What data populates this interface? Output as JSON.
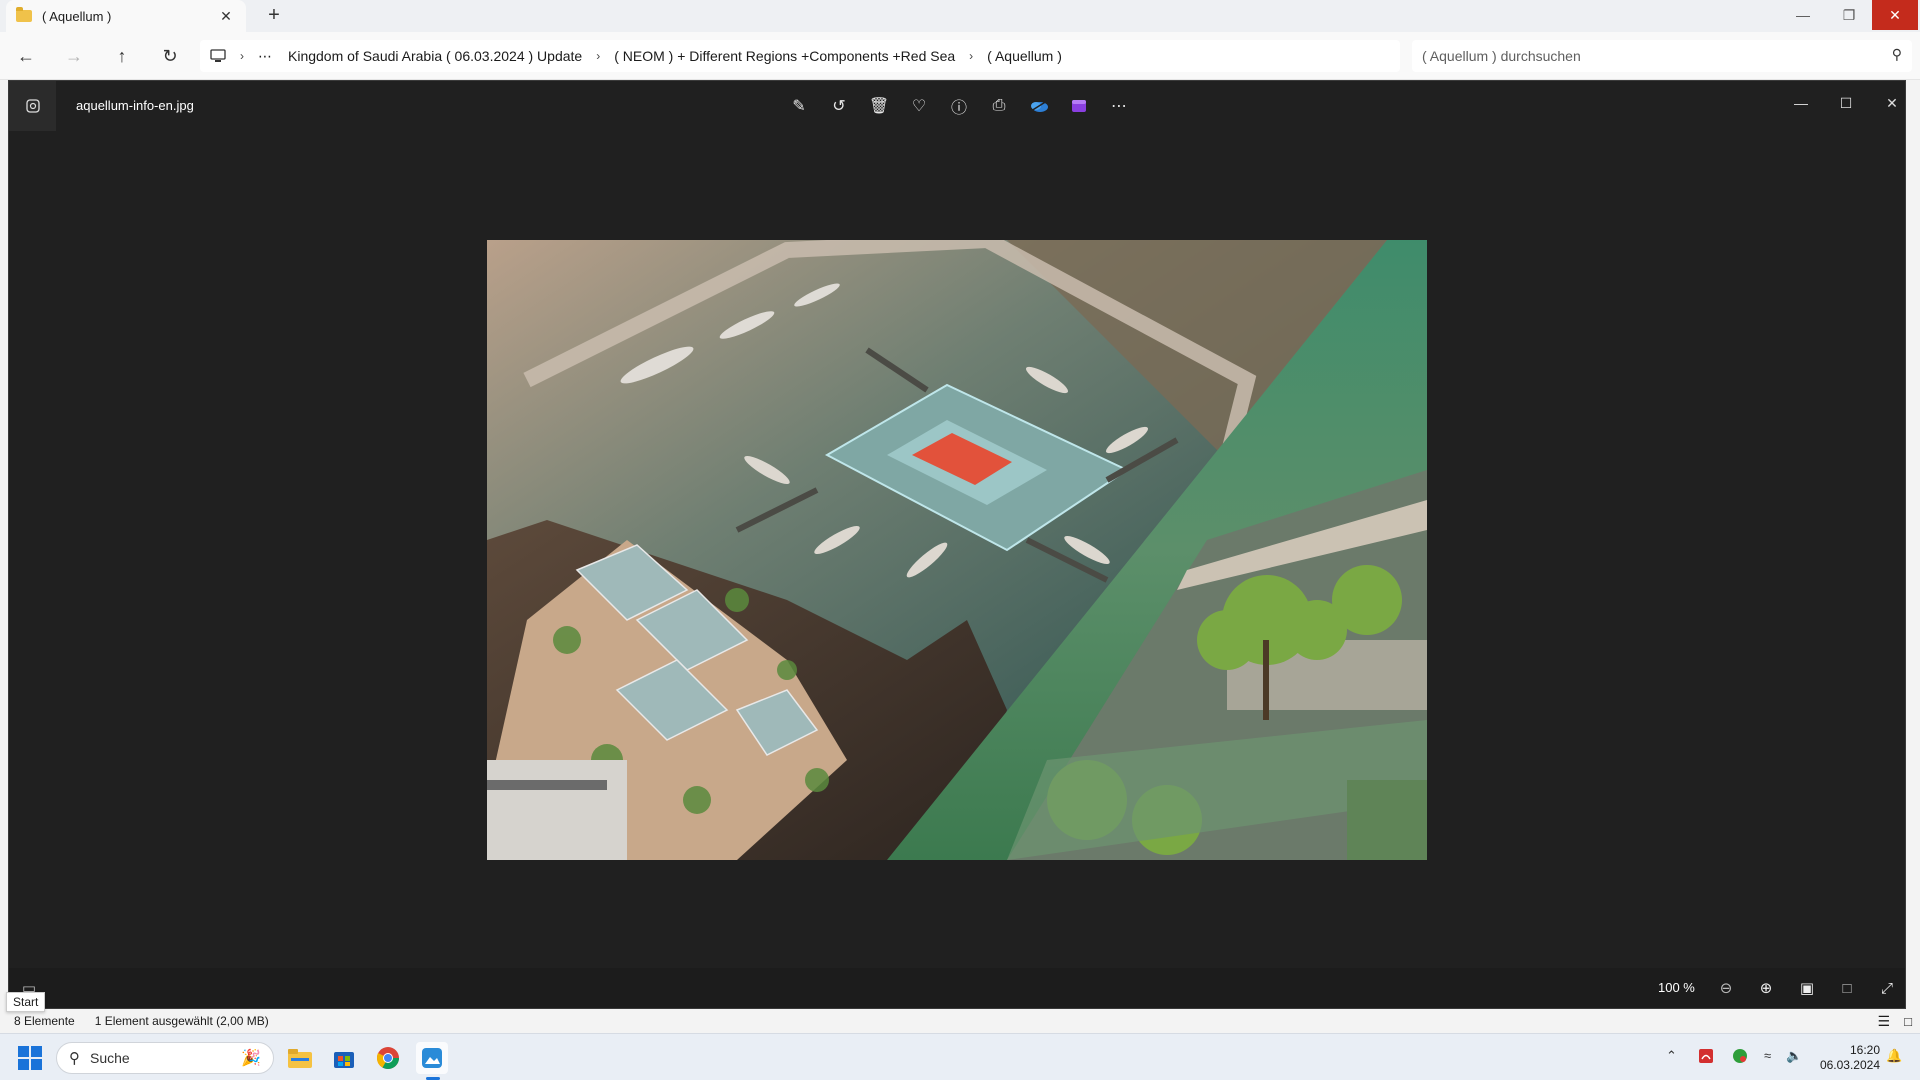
{
  "explorer": {
    "tab_title": "( Aquellum )",
    "tab_close": "✕",
    "new_tab": "+",
    "breadcrumb": [
      "Kingdom of Saudi Arabia ( 06.03.2024 ) Update",
      "( NEOM ) + Different Regions +Components +Red Sea",
      "( Aquellum )"
    ],
    "search_placeholder": "( Aquellum ) durchsuchen",
    "status": {
      "items_count": "8 Elemente",
      "selection": "1 Element ausgewählt (2,00 MB)"
    },
    "tooltip": "Start"
  },
  "viewer": {
    "file_name": "aquellum-info-en.jpg",
    "zoom": "100 %",
    "toolbar_icons": [
      "edit-icon",
      "rotate-icon",
      "delete-icon",
      "favorite-icon",
      "info-icon",
      "print-icon",
      "onedrive-icon",
      "clipchamp-icon",
      "more-icon"
    ]
  },
  "taskbar": {
    "search_label": "Suche",
    "time": "16:20",
    "date": "06.03.2024"
  },
  "colors": {
    "viewer_bg": "#202020",
    "close_red": "#c42b1c",
    "accent": "#1a73d9"
  }
}
